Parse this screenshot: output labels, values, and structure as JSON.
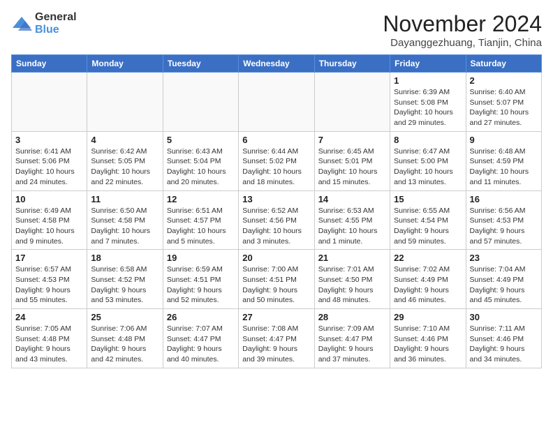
{
  "logo": {
    "general": "General",
    "blue": "Blue"
  },
  "header": {
    "month": "November 2024",
    "location": "Dayanggezhuang, Tianjin, China"
  },
  "weekdays": [
    "Sunday",
    "Monday",
    "Tuesday",
    "Wednesday",
    "Thursday",
    "Friday",
    "Saturday"
  ],
  "weeks": [
    [
      {
        "day": "",
        "info": ""
      },
      {
        "day": "",
        "info": ""
      },
      {
        "day": "",
        "info": ""
      },
      {
        "day": "",
        "info": ""
      },
      {
        "day": "",
        "info": ""
      },
      {
        "day": "1",
        "info": "Sunrise: 6:39 AM\nSunset: 5:08 PM\nDaylight: 10 hours and 29 minutes."
      },
      {
        "day": "2",
        "info": "Sunrise: 6:40 AM\nSunset: 5:07 PM\nDaylight: 10 hours and 27 minutes."
      }
    ],
    [
      {
        "day": "3",
        "info": "Sunrise: 6:41 AM\nSunset: 5:06 PM\nDaylight: 10 hours and 24 minutes."
      },
      {
        "day": "4",
        "info": "Sunrise: 6:42 AM\nSunset: 5:05 PM\nDaylight: 10 hours and 22 minutes."
      },
      {
        "day": "5",
        "info": "Sunrise: 6:43 AM\nSunset: 5:04 PM\nDaylight: 10 hours and 20 minutes."
      },
      {
        "day": "6",
        "info": "Sunrise: 6:44 AM\nSunset: 5:02 PM\nDaylight: 10 hours and 18 minutes."
      },
      {
        "day": "7",
        "info": "Sunrise: 6:45 AM\nSunset: 5:01 PM\nDaylight: 10 hours and 15 minutes."
      },
      {
        "day": "8",
        "info": "Sunrise: 6:47 AM\nSunset: 5:00 PM\nDaylight: 10 hours and 13 minutes."
      },
      {
        "day": "9",
        "info": "Sunrise: 6:48 AM\nSunset: 4:59 PM\nDaylight: 10 hours and 11 minutes."
      }
    ],
    [
      {
        "day": "10",
        "info": "Sunrise: 6:49 AM\nSunset: 4:58 PM\nDaylight: 10 hours and 9 minutes."
      },
      {
        "day": "11",
        "info": "Sunrise: 6:50 AM\nSunset: 4:58 PM\nDaylight: 10 hours and 7 minutes."
      },
      {
        "day": "12",
        "info": "Sunrise: 6:51 AM\nSunset: 4:57 PM\nDaylight: 10 hours and 5 minutes."
      },
      {
        "day": "13",
        "info": "Sunrise: 6:52 AM\nSunset: 4:56 PM\nDaylight: 10 hours and 3 minutes."
      },
      {
        "day": "14",
        "info": "Sunrise: 6:53 AM\nSunset: 4:55 PM\nDaylight: 10 hours and 1 minute."
      },
      {
        "day": "15",
        "info": "Sunrise: 6:55 AM\nSunset: 4:54 PM\nDaylight: 9 hours and 59 minutes."
      },
      {
        "day": "16",
        "info": "Sunrise: 6:56 AM\nSunset: 4:53 PM\nDaylight: 9 hours and 57 minutes."
      }
    ],
    [
      {
        "day": "17",
        "info": "Sunrise: 6:57 AM\nSunset: 4:53 PM\nDaylight: 9 hours and 55 minutes."
      },
      {
        "day": "18",
        "info": "Sunrise: 6:58 AM\nSunset: 4:52 PM\nDaylight: 9 hours and 53 minutes."
      },
      {
        "day": "19",
        "info": "Sunrise: 6:59 AM\nSunset: 4:51 PM\nDaylight: 9 hours and 52 minutes."
      },
      {
        "day": "20",
        "info": "Sunrise: 7:00 AM\nSunset: 4:51 PM\nDaylight: 9 hours and 50 minutes."
      },
      {
        "day": "21",
        "info": "Sunrise: 7:01 AM\nSunset: 4:50 PM\nDaylight: 9 hours and 48 minutes."
      },
      {
        "day": "22",
        "info": "Sunrise: 7:02 AM\nSunset: 4:49 PM\nDaylight: 9 hours and 46 minutes."
      },
      {
        "day": "23",
        "info": "Sunrise: 7:04 AM\nSunset: 4:49 PM\nDaylight: 9 hours and 45 minutes."
      }
    ],
    [
      {
        "day": "24",
        "info": "Sunrise: 7:05 AM\nSunset: 4:48 PM\nDaylight: 9 hours and 43 minutes."
      },
      {
        "day": "25",
        "info": "Sunrise: 7:06 AM\nSunset: 4:48 PM\nDaylight: 9 hours and 42 minutes."
      },
      {
        "day": "26",
        "info": "Sunrise: 7:07 AM\nSunset: 4:47 PM\nDaylight: 9 hours and 40 minutes."
      },
      {
        "day": "27",
        "info": "Sunrise: 7:08 AM\nSunset: 4:47 PM\nDaylight: 9 hours and 39 minutes."
      },
      {
        "day": "28",
        "info": "Sunrise: 7:09 AM\nSunset: 4:47 PM\nDaylight: 9 hours and 37 minutes."
      },
      {
        "day": "29",
        "info": "Sunrise: 7:10 AM\nSunset: 4:46 PM\nDaylight: 9 hours and 36 minutes."
      },
      {
        "day": "30",
        "info": "Sunrise: 7:11 AM\nSunset: 4:46 PM\nDaylight: 9 hours and 34 minutes."
      }
    ]
  ]
}
